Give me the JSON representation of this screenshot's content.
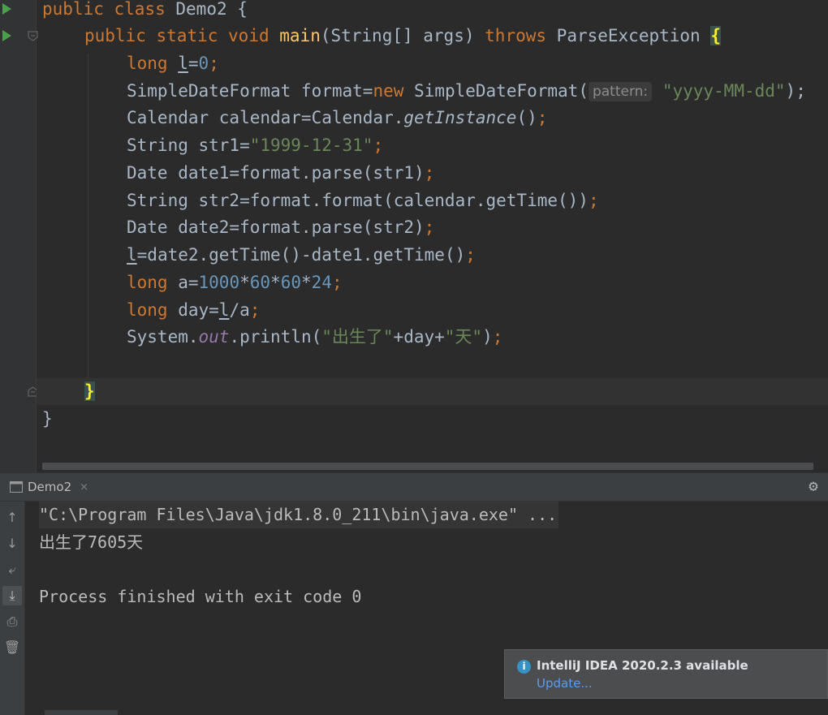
{
  "editor": {
    "lines": {
      "l1": {
        "kw1": "public",
        "kw2": "class",
        "name": "Demo2",
        "brace": "{"
      },
      "l2": {
        "kw1": "public",
        "kw2": "static",
        "kw3": "void",
        "method": "main",
        "params": "(String[] args)",
        "kw4": "throws",
        "exc": "ParseException",
        "brace": "{"
      },
      "l3": {
        "kw": "long",
        "var": "l",
        "eq": "=",
        "num": "0",
        "semi": ";"
      },
      "l4": {
        "a": "SimpleDateFormat format=",
        "kw": "new",
        "b": "SimpleDateFormat(",
        "hint": "pattern:",
        "str": "\"yyyy-MM-dd\"",
        "c": ");"
      },
      "l5": {
        "a": "Calendar calendar=Calendar.",
        "call": "getInstance",
        "b": "()",
        "semi": ";"
      },
      "l6": {
        "a": "String str1=",
        "str": "\"1999-12-31\"",
        "semi": ";"
      },
      "l7": {
        "a": "Date date1=format.parse(str1)",
        "semi": ";"
      },
      "l8": {
        "a": "String str2=format.format(calendar.getTime())",
        "semi": ";"
      },
      "l9": {
        "a": "Date date2=format.parse(str2)",
        "semi": ";"
      },
      "l10": {
        "var": "l",
        "a": "=date2.getTime()-date1.getTime()",
        "semi": ";"
      },
      "l11": {
        "kw": "long",
        "a": " a=",
        "n1": "1000",
        "m1": "*",
        "n2": "60",
        "m2": "*",
        "n3": "60",
        "m3": "*",
        "n4": "24",
        "semi": ";"
      },
      "l12": {
        "kw": "long",
        "a": " day=",
        "var": "l",
        "b": "/a",
        "semi": ";"
      },
      "l13": {
        "a": "System.",
        "field": "out",
        "b": ".println(",
        "s1": "\"出生了\"",
        "c": "+day+",
        "s2": "\"天\"",
        "d": ")",
        "semi": ";"
      },
      "l15": {
        "brace": "}"
      },
      "l16": {
        "brace": "}"
      }
    }
  },
  "run_panel": {
    "tab_label": "Demo2",
    "tab_close": "×",
    "console": [
      "\"C:\\Program Files\\Java\\jdk1.8.0_211\\bin\\java.exe\" ...",
      "出生了7605天",
      "Process finished with exit code 0"
    ]
  },
  "notification": {
    "title": "IntelliJ IDEA 2020.2.3 available",
    "link": "Update..."
  },
  "icons": {
    "run": "run-triangle-icon",
    "fold": "fold-marker-icon",
    "gear": "gear-icon",
    "info": "info-icon"
  },
  "colors": {
    "keyword": "#cc7832",
    "method": "#ffc66d",
    "number": "#6897bb",
    "string": "#6a8759",
    "field": "#9876aa",
    "text": "#a9b7c6",
    "background": "#2b2b2b"
  }
}
